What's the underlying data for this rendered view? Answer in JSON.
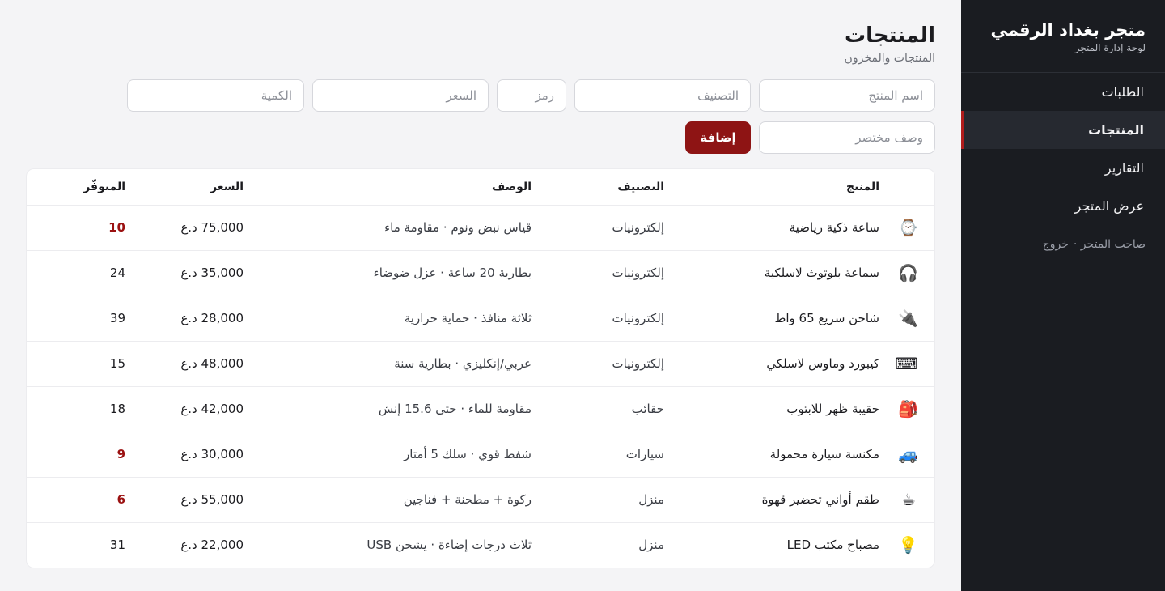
{
  "sidebar": {
    "title": "متجر بغداد الرقمي",
    "subtitle": "لوحة إدارة المتجر",
    "items": [
      {
        "label": "الطلبات"
      },
      {
        "label": "المنتجات"
      },
      {
        "label": "التقارير"
      },
      {
        "label": "عرض المتجر"
      }
    ],
    "footer_user": "صاحب المتجر ·",
    "footer_logout": "خروج"
  },
  "header": {
    "title": "المنتجات",
    "subtitle": "المنتجات والمخزون"
  },
  "form": {
    "name_placeholder": "اسم المنتج",
    "category_placeholder": "التصنيف",
    "code_placeholder": "رمز",
    "price_placeholder": "السعر",
    "qty_placeholder": "الكمية",
    "desc_placeholder": "وصف مختصر",
    "add_label": "إضافة"
  },
  "table": {
    "headers": {
      "product": "المنتج",
      "category": "التصنيف",
      "description": "الوصف",
      "price": "السعر",
      "stock": "المتوفّر"
    },
    "rows": [
      {
        "icon": "⌚",
        "name": "ساعة ذكية رياضية",
        "category": "إلكترونيات",
        "description": "قياس نبض ونوم · مقاومة ماء",
        "price": "75,000 د.ع",
        "stock": "10"
      },
      {
        "icon": "🎧",
        "name": "سماعة بلوتوث لاسلكية",
        "category": "إلكترونيات",
        "description": "بطارية 20 ساعة · عزل ضوضاء",
        "price": "35,000 د.ع",
        "stock": "24"
      },
      {
        "icon": "🔌",
        "name": "شاحن سريع 65 واط",
        "category": "إلكترونيات",
        "description": "ثلاثة منافذ · حماية حرارية",
        "price": "28,000 د.ع",
        "stock": "39"
      },
      {
        "icon": "⌨",
        "name": "كيبورد وماوس لاسلكي",
        "category": "إلكترونيات",
        "description": "عربي/إنكليزي · بطارية سنة",
        "price": "48,000 د.ع",
        "stock": "15"
      },
      {
        "icon": "🎒",
        "name": "حقيبة ظهر للابتوب",
        "category": "حقائب",
        "description": "مقاومة للماء · حتى 15.6 إنش",
        "price": "42,000 د.ع",
        "stock": "18"
      },
      {
        "icon": "🚙",
        "name": "مكنسة سيارة محمولة",
        "category": "سيارات",
        "description": "شفط قوي · سلك 5 أمتار",
        "price": "30,000 د.ع",
        "stock": "9"
      },
      {
        "icon": "☕",
        "name": "طقم أواني تحضير قهوة",
        "category": "منزل",
        "description": "ركوة + مطحنة + فناجين",
        "price": "55,000 د.ع",
        "stock": "6"
      },
      {
        "icon": "💡",
        "name": "مصباح مكتب LED",
        "category": "منزل",
        "description": "ثلاث درجات إضاءة · يشحن USB",
        "price": "22,000 د.ع",
        "stock": "31"
      }
    ]
  },
  "colors": {
    "accent": "#8e1414",
    "sidebar_bg": "#1a1c21",
    "low_stock": "#9b1111"
  }
}
